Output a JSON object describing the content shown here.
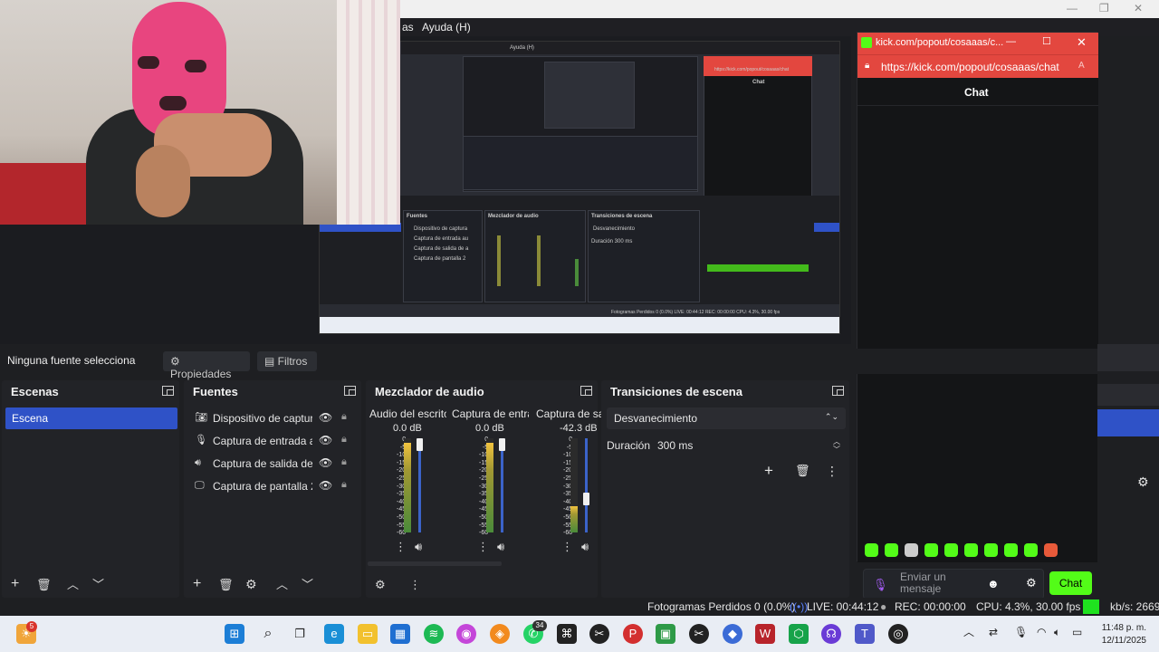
{
  "menubar": {
    "visible_item": "as",
    "help": "Ayuda (H)"
  },
  "popup": {
    "title": "kick.com/popout/cosaaas/c...",
    "url": "https://kick.com/popout/cosaaas/chat",
    "chat_header": "Chat",
    "input_placeholder": "Enviar un mensaje",
    "send_label": "Chat"
  },
  "preview": {
    "mini_help": "Ayuda (H)",
    "mini_url": "https://kick.com/popout/cosaaas/chat",
    "mini_chat": "Chat",
    "mini_sources_title": "Fuentes",
    "mini_mixer_title": "Mezclador de audio",
    "mini_trans_title": "Transiciones de escena",
    "mini_sources": [
      "Dispositivo de captura",
      "Captura de entrada au",
      "Captura de salida de a",
      "Captura de pantalla 2"
    ],
    "mini_trans": "Desvanecimiento",
    "mini_duration": "Duración  300 ms",
    "mini_status": "Fotogramas Perdidos 0 (0.0%)  LIVE: 00:44:12  REC: 00:00:00  CPU: 4.3%, 30.00 fps"
  },
  "source_bar": {
    "label": "Ninguna fuente selecciona",
    "properties": "Propiedades",
    "filters": "Filtros"
  },
  "scenes": {
    "title": "Escenas",
    "items": [
      "Escena"
    ]
  },
  "sources": {
    "title": "Fuentes",
    "items": [
      {
        "name": "Dispositivo de captura",
        "icon": "camera-icon"
      },
      {
        "name": "Captura de entrada au",
        "icon": "microphone-icon"
      },
      {
        "name": "Captura de salida de a",
        "icon": "speaker-icon"
      },
      {
        "name": "Captura de pantalla 2",
        "icon": "monitor-icon"
      }
    ]
  },
  "mixer": {
    "title": "Mezclador de audio",
    "channels": [
      {
        "name": "Audio del escrito",
        "db": "0.0 dB",
        "level": 0.95,
        "fader": 1.0
      },
      {
        "name": "Captura de entra",
        "db": "0.0 dB",
        "level": 0.95,
        "fader": 1.0
      },
      {
        "name": "Captura de sa",
        "db": "-42.3 dB",
        "level": 0.28,
        "fader": 0.33
      }
    ],
    "scale": [
      "0",
      "-5",
      "-10",
      "-15",
      "-20",
      "-25",
      "-30",
      "-35",
      "-40",
      "-45",
      "-50",
      "-55",
      "-60"
    ]
  },
  "transitions": {
    "title": "Transiciones de escena",
    "selected": "Desvanecimiento",
    "duration_label": "Duración",
    "duration_value": "300 ms"
  },
  "status": {
    "dropped": "Fotogramas Perdidos 0 (0.0%)",
    "live": "LIVE: 00:44:12",
    "rec": "REC: 00:00:00",
    "cpu": "CPU: 4.3%, 30.00 fps",
    "kbs": "kb/s: 2669"
  },
  "taskbar": {
    "time": "11:48 p. m.",
    "date": "12/11/2025",
    "badge_weather": "5",
    "badge_whatsapp": "34"
  },
  "colors": {
    "accent": "#2f52c7",
    "kick_green": "#53fc18",
    "popup_red": "#e3473f"
  }
}
